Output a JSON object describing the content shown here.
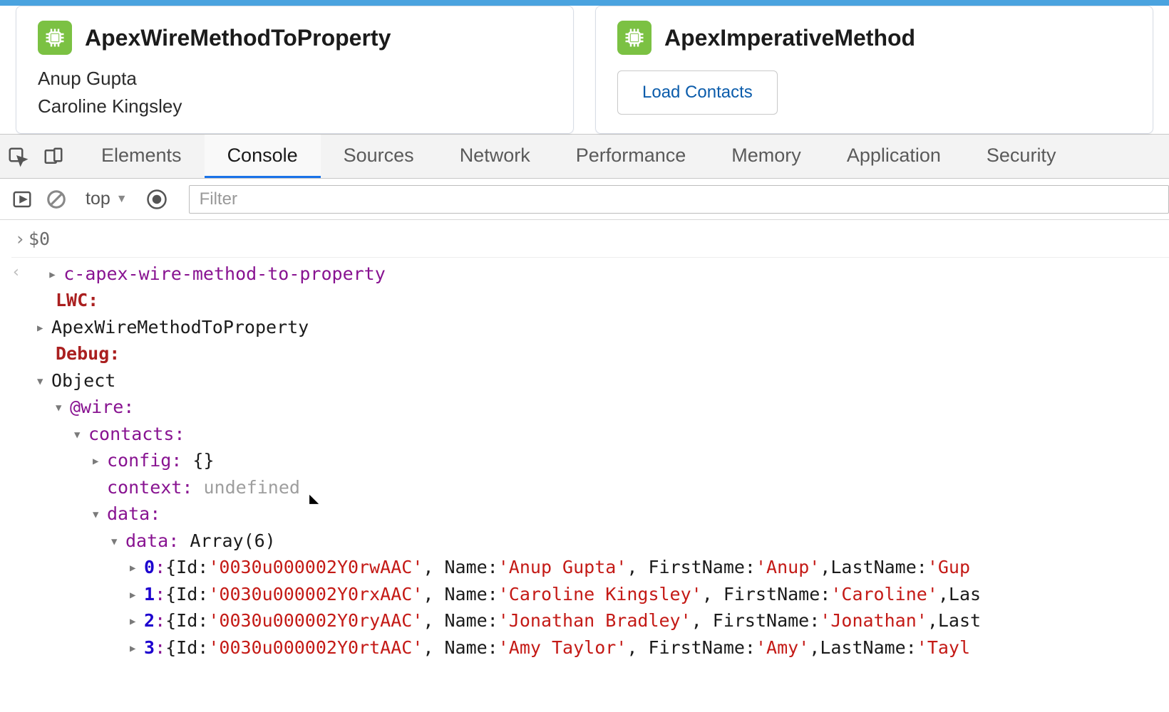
{
  "cards": {
    "left": {
      "title": "ApexWireMethodToProperty",
      "contacts": [
        "Anup Gupta",
        "Caroline Kingsley"
      ]
    },
    "right": {
      "title": "ApexImperativeMethod",
      "button": "Load Contacts"
    }
  },
  "devtools": {
    "tabs": [
      "Elements",
      "Console",
      "Sources",
      "Network",
      "Performance",
      "Memory",
      "Application",
      "Security"
    ],
    "active_tab": "Console",
    "context": "top",
    "filter_placeholder": "Filter"
  },
  "console": {
    "first_expr": "$0",
    "lines": {
      "component_tag": "c-apex-wire-method-to-property",
      "lwc_label": "LWC:",
      "component_name": "ApexWireMethodToProperty",
      "debug_label": "Debug:",
      "object_label": "Object",
      "wire_label": "@wire:",
      "contacts_label": "contacts:",
      "config_label": "config:",
      "config_val": "{}",
      "context_label": "context:",
      "context_val": "undefined",
      "data_label": "data:",
      "inner_data_label": "data:",
      "inner_data_val": "Array(6)"
    },
    "records": [
      {
        "idx": "0",
        "Id": "0030u000002Y0rwAAC",
        "Name": "Anup Gupta",
        "FirstName": "Anup",
        "LastName": "Gup"
      },
      {
        "idx": "1",
        "Id": "0030u000002Y0rxAAC",
        "Name": "Caroline Kingsley",
        "FirstName": "Caroline",
        "LastName": "Las"
      },
      {
        "idx": "2",
        "Id": "0030u000002Y0ryAAC",
        "Name": "Jonathan Bradley",
        "FirstName": "Jonathan",
        "LastName": "Last"
      },
      {
        "idx": "3",
        "Id": "0030u000002Y0rtAAC",
        "Name": "Amy Taylor",
        "FirstName": "Amy",
        "LastName": "Tayl"
      }
    ]
  }
}
